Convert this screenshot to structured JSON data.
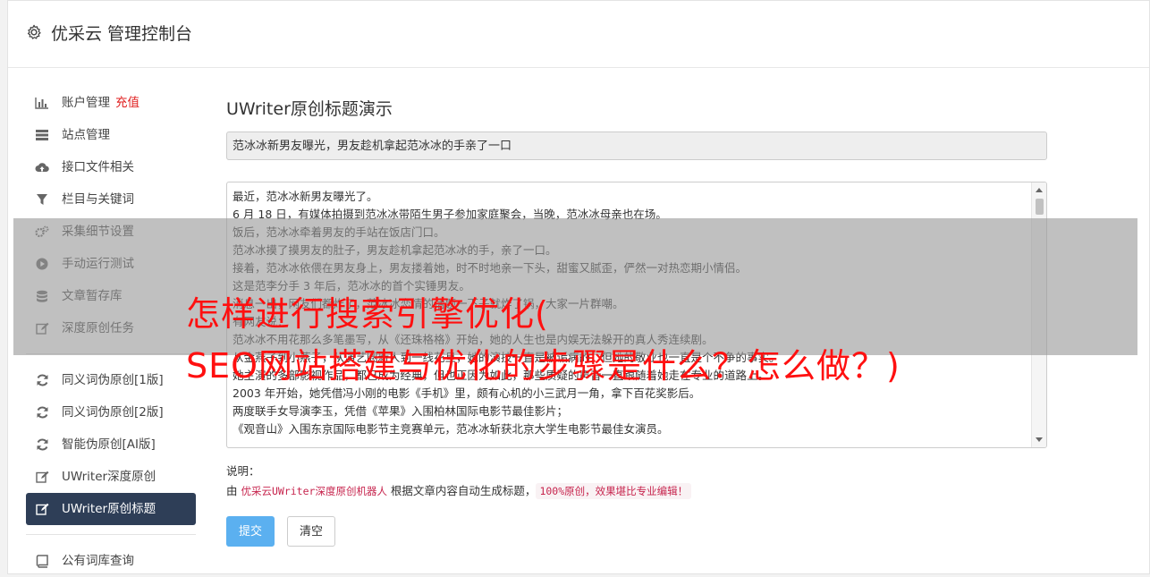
{
  "app_title": "优采云 管理控制台",
  "sidebar": {
    "group1": [
      {
        "label": "账户管理",
        "badge": "充值",
        "icon": "bar-chart-icon"
      },
      {
        "label": "站点管理",
        "icon": "server-icon"
      },
      {
        "label": "接口文件相关",
        "icon": "cloud-upload-icon"
      },
      {
        "label": "栏目与关键词",
        "icon": "filter-icon"
      },
      {
        "label": "采集细节设置",
        "icon": "gears-icon"
      },
      {
        "label": "手动运行测试",
        "icon": "play-circle-icon"
      },
      {
        "label": "文章暂存库",
        "icon": "database-icon"
      },
      {
        "label": "深度原创任务",
        "icon": "edit-icon"
      }
    ],
    "group2": [
      {
        "label": "同义词伪原创[1版]",
        "icon": "refresh-icon"
      },
      {
        "label": "同义词伪原创[2版]",
        "icon": "refresh-icon"
      },
      {
        "label": "智能伪原创[AI版]",
        "icon": "refresh-icon"
      },
      {
        "label": "UWriter深度原创",
        "icon": "edit-icon"
      },
      {
        "label": "UWriter原创标题",
        "icon": "edit-icon",
        "active": true
      }
    ],
    "group3": [
      {
        "label": "公有词库查询",
        "icon": "book-icon"
      }
    ]
  },
  "main": {
    "heading": "UWriter原创标题演示",
    "title_value": "范冰冰新男友曝光，男友趁机拿起范冰冰的手亲了一口",
    "content_lines": [
      "最近，范冰冰新男友曝光了。",
      "6 月 18 日，有媒体拍摄到范冰冰带陌生男子参加家庭聚会，当晚，范冰冰母亲也在场。",
      "饭后，范冰冰牵着男友的手站在饭店门口。",
      "范冰冰摸了摸男友的肚子，男友趁机拿起范冰冰的手，亲了一口。",
      "接着，范冰冰依偎在男友身上，男友搂着她，时不时地亲一下头，甜蜜又腻歪，俨然一对热恋期小情侣。",
      "这是范李分手 3 年后，范冰冰的首个实锤男友。",
      "消息一出，网友们都炸了，范冰冰恋情的话题一下子就炸了锅，大家一片群嘲。",
      "有网友说：",
      "范冰冰不用花那么多笔墨写，从《还珠格格》开始，她的人生也是内娱无法躲开的真人秀连续剧。",
      "从金燕子到小燕子，从演艺圈新人到一线花旦，她的演技一直是被诟病的，但她的敬业也一直是个不争的事实。",
      "她主演的多部影视作品，都已成为经典，但也正因为如此，那些质疑的声音一直跟随着她走在专业的道路上。",
      "2003 年开始，她凭借冯小刚的电影《手机》里，颇有心机的小三武月一角，拿下百花奖影后。",
      "两度联手女导演李玉，凭借《苹果》入围柏林国际电影节最佳影片；",
      "《观音山》入围东京国际电影节主竞赛单元，范冰冰斩获北京大学生电影节最佳女演员。"
    ],
    "note_label": "说明：",
    "note_prefix": "由 ",
    "note_highlight": "优采云UWriter深度原创机器人",
    "note_middle": " 根据文章内容自动生成标题，",
    "note_tag": "100%原创，效果堪比专业编辑！",
    "submit_label": "提交",
    "clear_label": "清空"
  },
  "overlay": {
    "line1": "怎样进行搜索引擎优化(",
    "line2": "SEO网站搭建与优化的步骤是什么？怎么做？)"
  }
}
